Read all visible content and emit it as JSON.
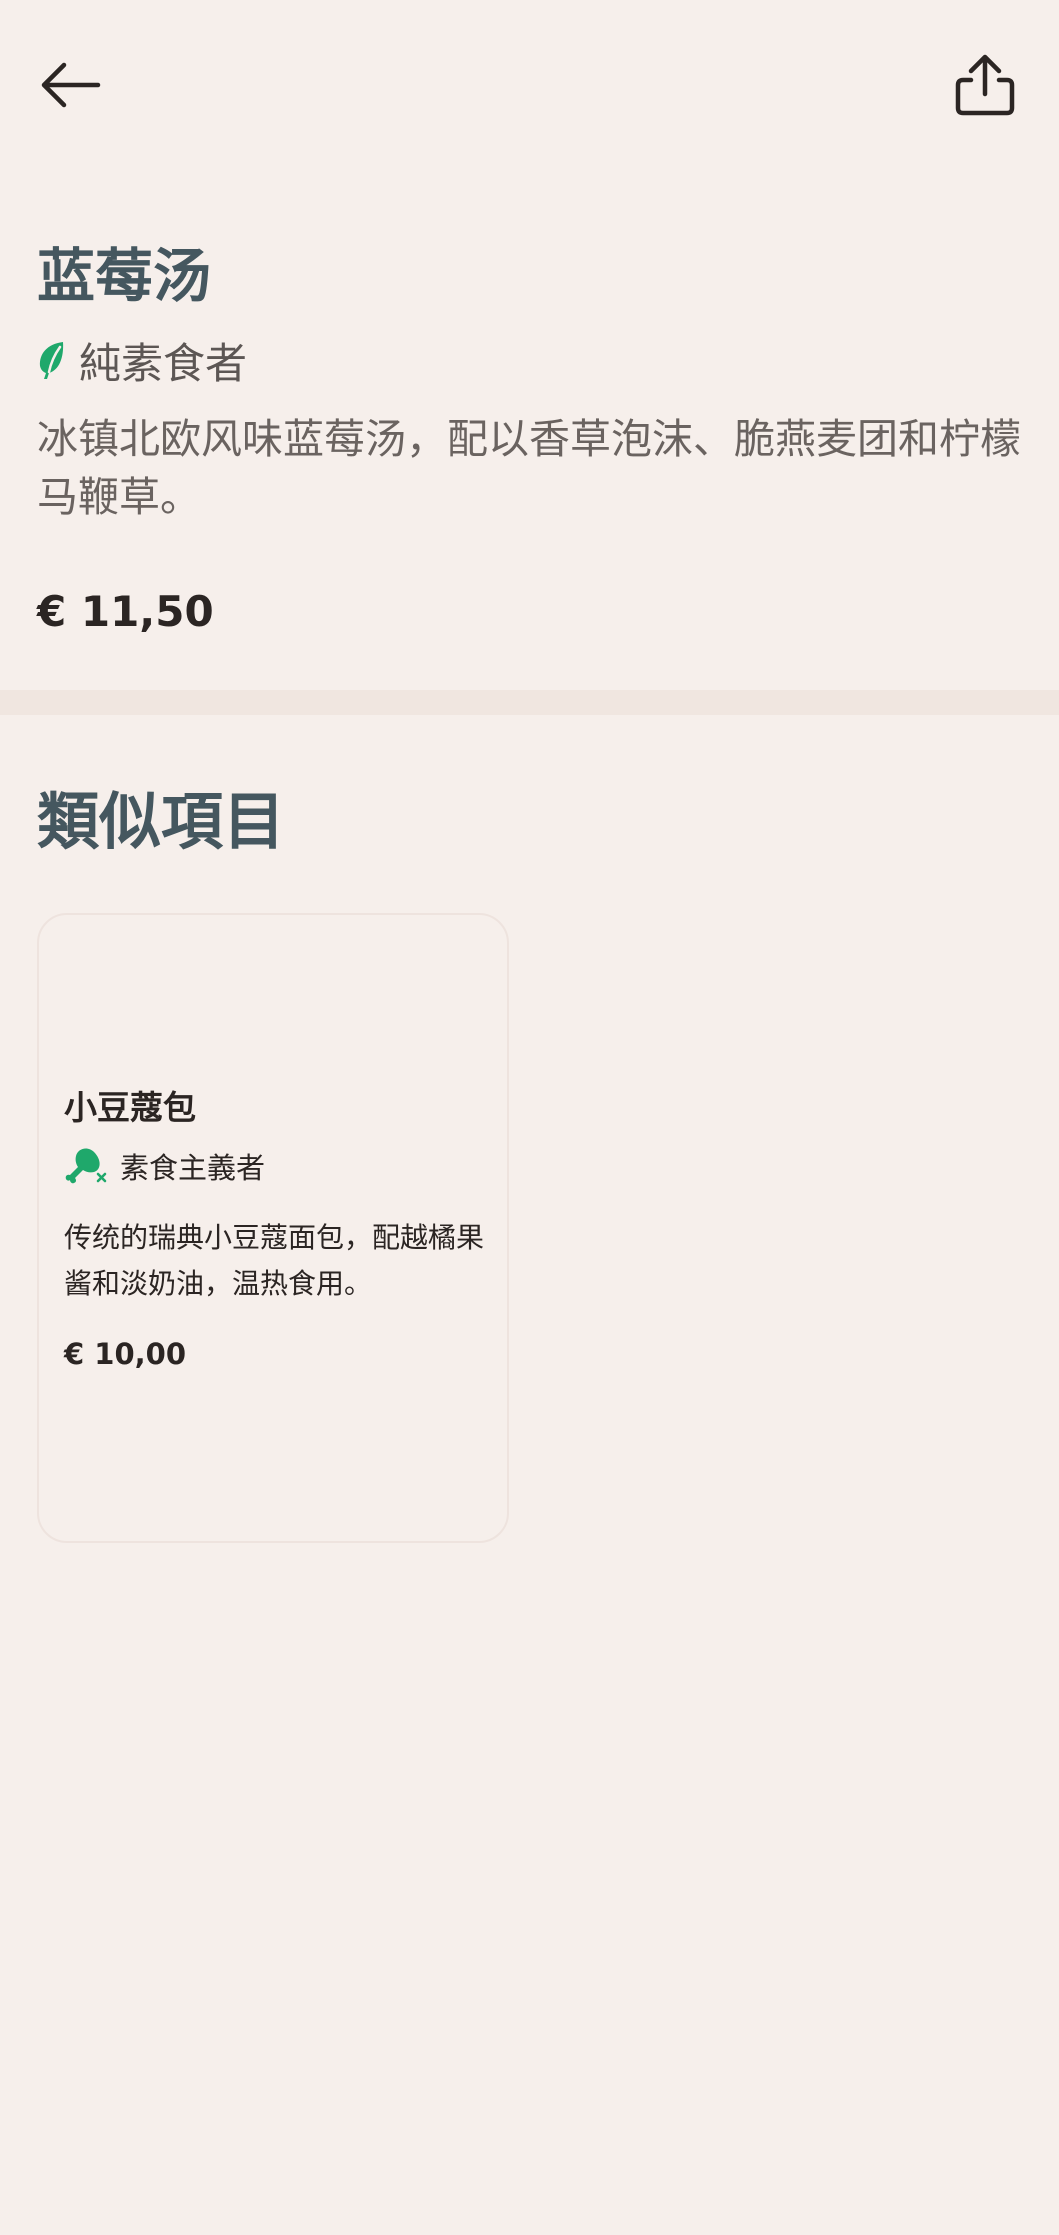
{
  "item": {
    "title": "蓝莓汤",
    "diet_label": "純素食者",
    "description": "冰镇北欧风味蓝莓汤，配以香草泡沫、脆燕麦团和柠檬马鞭草。",
    "price": "€ 11,50"
  },
  "similar": {
    "section_title": "類似項目",
    "items": [
      {
        "title": "小豆蔻包",
        "diet_label": "素食主義者",
        "description": "传统的瑞典小豆蔻面包，配越橘果酱和淡奶油，温热食用。",
        "price": "€ 10,00"
      }
    ]
  },
  "icons": {
    "back": "arrow-left-icon",
    "share": "share-icon",
    "vegan": "leaf-icon",
    "vegetarian": "no-meat-drumstick-icon"
  },
  "colors": {
    "background": "#f6efeb",
    "heading": "#45575f",
    "accent_green": "#1fa86b"
  }
}
